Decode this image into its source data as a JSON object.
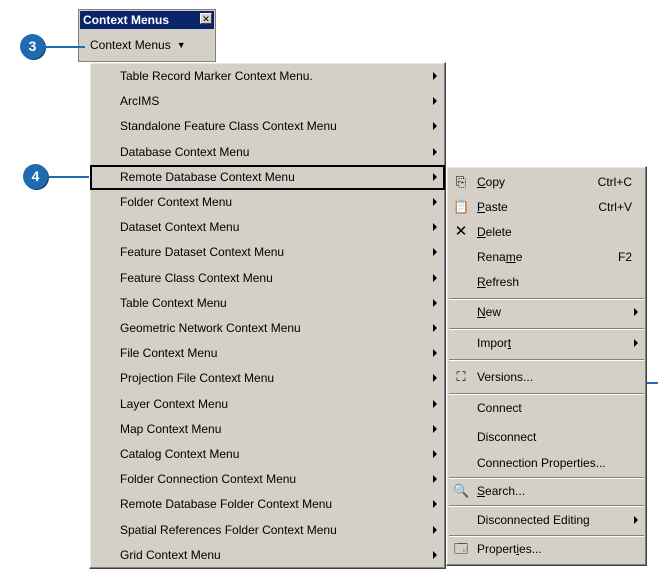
{
  "toolbar": {
    "title": "Context Menus",
    "close_glyph": "✕",
    "button_label": "Context Menus",
    "caret": "▼"
  },
  "callouts": {
    "step3": "3",
    "step4": "4"
  },
  "main_menu": {
    "items": [
      "Table Record Marker Context Menu.",
      "ArcIMS",
      "Standalone Feature Class Context Menu",
      "Database Context Menu",
      "Remote Database Context Menu",
      "Folder Context Menu",
      "Dataset Context Menu",
      "Feature Dataset Context Menu",
      "Feature Class Context Menu",
      "Table Context Menu",
      "Geometric Network Context Menu",
      "File Context Menu",
      "Projection File Context Menu",
      "Layer Context Menu",
      "Map Context Menu",
      "Catalog Context Menu",
      "Folder Connection Context Menu",
      "Remote Database Folder Context Menu",
      "Spatial References Folder Context Menu",
      "Grid Context Menu"
    ],
    "highlighted": "Remote Database Context Menu"
  },
  "submenu": {
    "copy": {
      "mn": "C",
      "rest": "opy",
      "shortcut": "Ctrl+C",
      "icon": "copy-icon"
    },
    "paste": {
      "mn": "P",
      "rest": "aste",
      "shortcut": "Ctrl+V",
      "icon": "paste-icon"
    },
    "delete": {
      "mn": "D",
      "rest": "elete",
      "icon": "delete-icon"
    },
    "rename": {
      "pre": "Rena",
      "mn": "m",
      "rest": "e",
      "shortcut": "F2"
    },
    "refresh": {
      "mn": "R",
      "rest": "efresh"
    },
    "new": {
      "mn": "N",
      "rest": "ew"
    },
    "import": {
      "pre": "Impor",
      "mn": "t",
      "rest": ""
    },
    "versions": {
      "label": "Versions...",
      "icon": "versions-icon"
    },
    "connect": {
      "label": "Connect"
    },
    "disconnect": {
      "label": "Disconnect"
    },
    "connection_properties": {
      "label": "Connection Properties..."
    },
    "search": {
      "mn": "S",
      "rest": "earch...",
      "icon": "search-icon"
    },
    "disconnected_editing": {
      "label": "Disconnected Editing"
    },
    "properties": {
      "pre": "Propert",
      "mn": "i",
      "rest": "es...",
      "icon": "properties-icon"
    }
  }
}
